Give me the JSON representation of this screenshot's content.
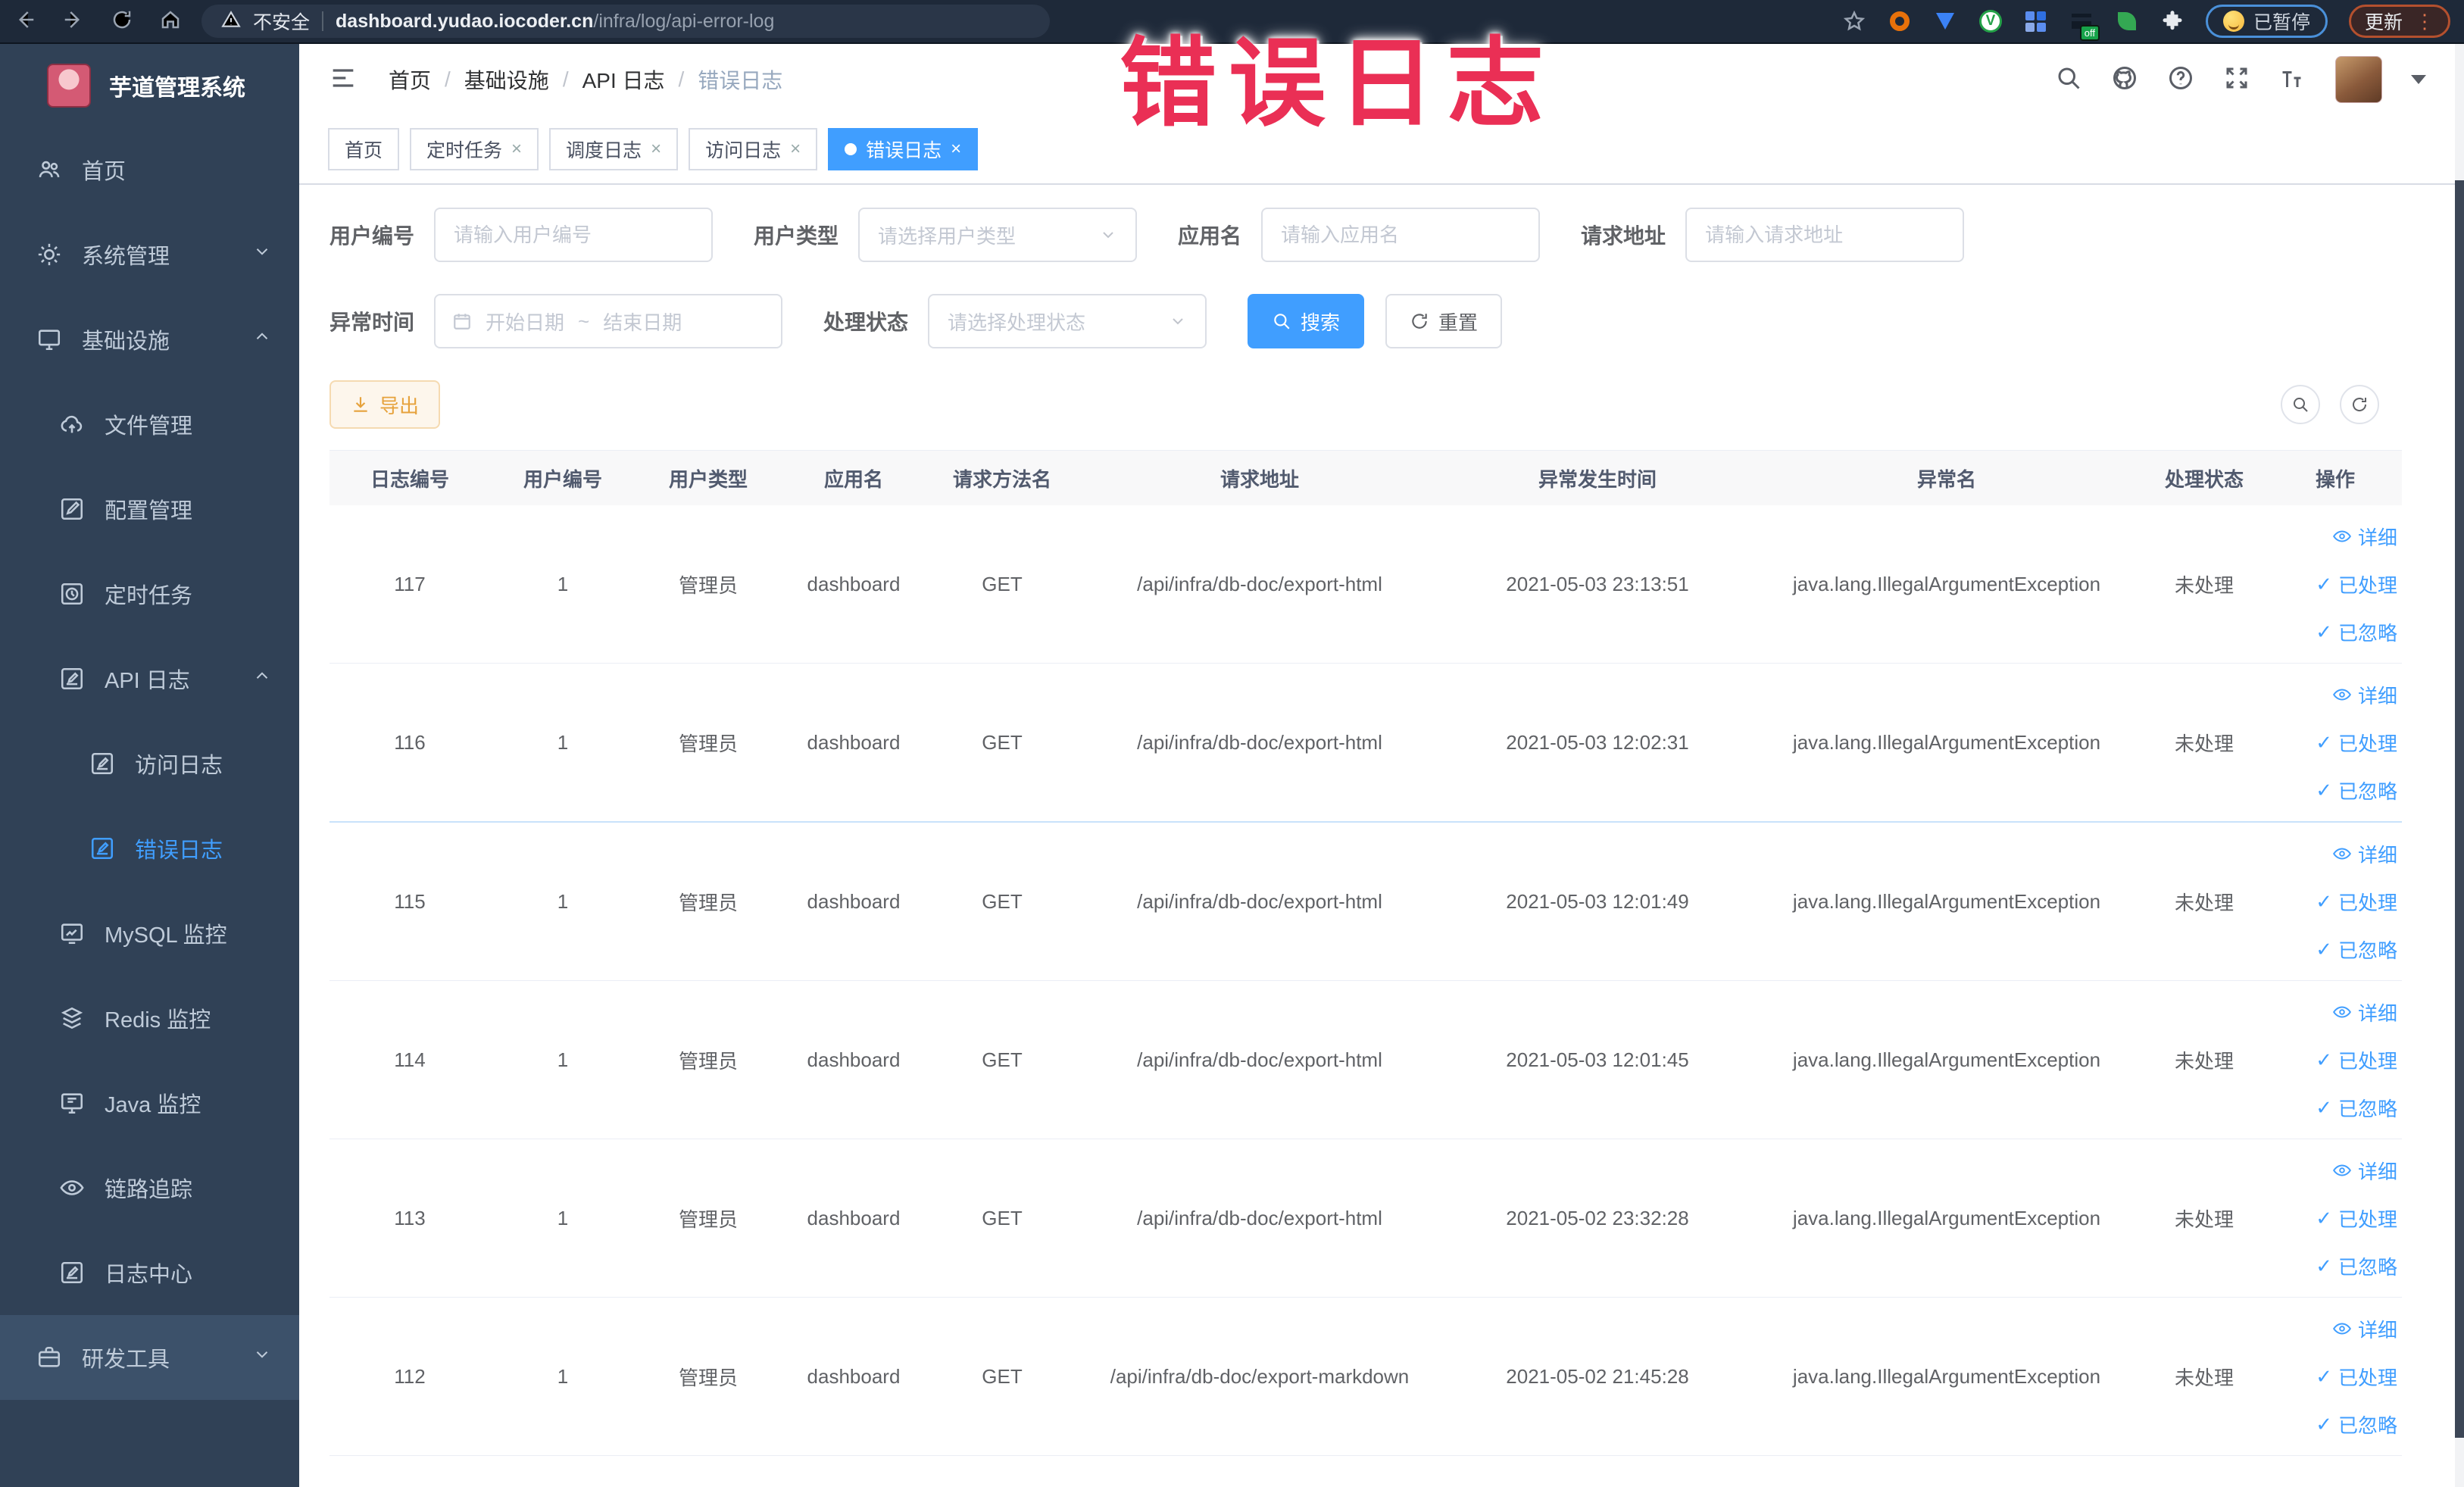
{
  "browser": {
    "security_label": "不安全",
    "url_host": "dashboard.yudao.iocoder.cn",
    "url_path": "/infra/log/api-error-log",
    "paused_badge": "已暂停",
    "update_button": "更新",
    "kebab": "⋮",
    "off_badge": "off"
  },
  "annotation": {
    "text": "错误日志",
    "color": "#ea2f55"
  },
  "colors": {
    "accent": "#409eff",
    "warning": "#e6a23c",
    "sidebar_bg": "#304156"
  },
  "sidebar": {
    "title": "芋道管理系统",
    "items": [
      {
        "icon": "users-icon",
        "label": "首页"
      },
      {
        "icon": "gear-icon",
        "label": "系统管理",
        "chevron": "down"
      },
      {
        "icon": "monitor-icon",
        "label": "基础设施",
        "chevron": "up",
        "children": [
          {
            "icon": "cloud-upload-icon",
            "label": "文件管理"
          },
          {
            "icon": "edit-square-icon",
            "label": "配置管理"
          },
          {
            "icon": "timer-icon",
            "label": "定时任务"
          },
          {
            "icon": "doc-edit-icon",
            "label": "API 日志",
            "chevron": "up",
            "children": [
              {
                "icon": "doc-edit-icon",
                "label": "访问日志"
              },
              {
                "icon": "doc-edit-icon",
                "label": "错误日志",
                "active": true
              }
            ]
          },
          {
            "icon": "chart-board-icon",
            "label": "MySQL 监控"
          },
          {
            "icon": "stack-icon",
            "label": "Redis 监控"
          },
          {
            "icon": "java-monitor-icon",
            "label": "Java 监控"
          },
          {
            "icon": "eye-icon",
            "label": "链路追踪"
          },
          {
            "icon": "doc-edit-icon",
            "label": "日志中心"
          }
        ]
      },
      {
        "icon": "briefcase-icon",
        "label": "研发工具",
        "chevron": "down",
        "highlighted": true
      }
    ]
  },
  "breadcrumb": [
    "首页",
    "基础设施",
    "API 日志",
    "错误日志"
  ],
  "tabs": [
    {
      "label": "首页",
      "closable": false,
      "active": false
    },
    {
      "label": "定时任务",
      "closable": true,
      "active": false
    },
    {
      "label": "调度日志",
      "closable": true,
      "active": false
    },
    {
      "label": "访问日志",
      "closable": true,
      "active": false
    },
    {
      "label": "错误日志",
      "closable": true,
      "active": true
    }
  ],
  "filters": {
    "row1": [
      {
        "label": "用户编号",
        "type": "input",
        "placeholder": "请输入用户编号"
      },
      {
        "label": "用户类型",
        "type": "select",
        "placeholder": "请选择用户类型"
      },
      {
        "label": "应用名",
        "type": "input",
        "placeholder": "请输入应用名"
      },
      {
        "label": "请求地址",
        "type": "input",
        "placeholder": "请输入请求地址"
      }
    ],
    "row2": {
      "date_label": "异常时间",
      "date_start_placeholder": "开始日期",
      "date_separator": "~",
      "date_end_placeholder": "结束日期",
      "status_label": "处理状态",
      "status_placeholder": "请选择处理状态",
      "search_label": "搜索",
      "reset_label": "重置"
    }
  },
  "toolbar": {
    "export_label": "导出"
  },
  "table": {
    "columns": [
      "日志编号",
      "用户编号",
      "用户类型",
      "应用名",
      "请求方法名",
      "请求地址",
      "异常发生时间",
      "异常名",
      "处理状态",
      "操作"
    ],
    "actions": [
      {
        "label": "详细",
        "icon": "eye-icon"
      },
      {
        "label": "已处理",
        "icon": "check-icon"
      },
      {
        "label": "已忽略",
        "icon": "check-icon"
      }
    ],
    "rows": [
      {
        "id": "117",
        "user_id": "1",
        "user_type": "管理员",
        "app_name": "dashboard",
        "method": "GET",
        "url": "/api/infra/db-doc/export-html",
        "time": "2021-05-03 23:13:51",
        "exception": "java.lang.IllegalArgumentException",
        "status": "未处理",
        "blue_divider": false
      },
      {
        "id": "116",
        "user_id": "1",
        "user_type": "管理员",
        "app_name": "dashboard",
        "method": "GET",
        "url": "/api/infra/db-doc/export-html",
        "time": "2021-05-03 12:02:31",
        "exception": "java.lang.IllegalArgumentException",
        "status": "未处理",
        "blue_divider": true
      },
      {
        "id": "115",
        "user_id": "1",
        "user_type": "管理员",
        "app_name": "dashboard",
        "method": "GET",
        "url": "/api/infra/db-doc/export-html",
        "time": "2021-05-03 12:01:49",
        "exception": "java.lang.IllegalArgumentException",
        "status": "未处理",
        "blue_divider": false
      },
      {
        "id": "114",
        "user_id": "1",
        "user_type": "管理员",
        "app_name": "dashboard",
        "method": "GET",
        "url": "/api/infra/db-doc/export-html",
        "time": "2021-05-03 12:01:45",
        "exception": "java.lang.IllegalArgumentException",
        "status": "未处理",
        "blue_divider": false
      },
      {
        "id": "113",
        "user_id": "1",
        "user_type": "管理员",
        "app_name": "dashboard",
        "method": "GET",
        "url": "/api/infra/db-doc/export-html",
        "time": "2021-05-02 23:32:28",
        "exception": "java.lang.IllegalArgumentException",
        "status": "未处理",
        "blue_divider": false
      },
      {
        "id": "112",
        "user_id": "1",
        "user_type": "管理员",
        "app_name": "dashboard",
        "method": "GET",
        "url": "/api/infra/db-doc/export-markdown",
        "time": "2021-05-02 21:45:28",
        "exception": "java.lang.IllegalArgumentException",
        "status": "未处理",
        "blue_divider": false
      }
    ]
  }
}
